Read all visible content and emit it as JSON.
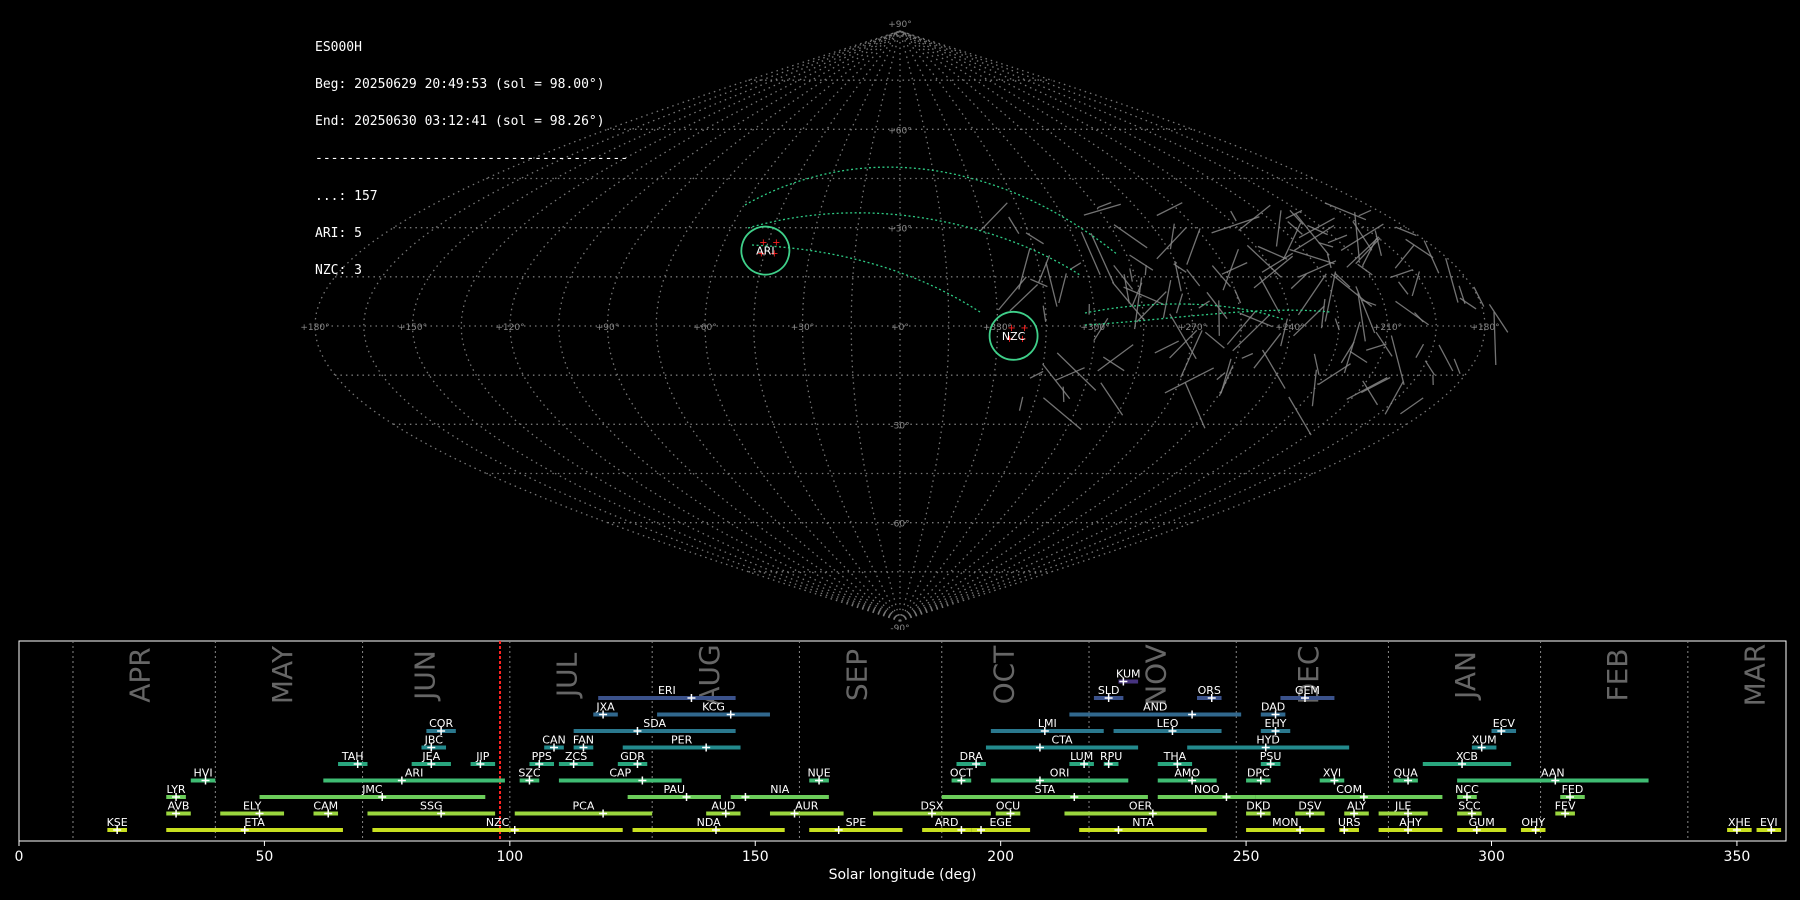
{
  "info": {
    "station": "ES000H",
    "begin": "Beg: 20250629 20:49:53 (sol = 98.00°)",
    "end": "End: 20250630 03:12:41 (sol = 98.26°)",
    "separator": "----------------------------------------",
    "counts": [
      "...: 157",
      "ARI: 5",
      "NZC: 3"
    ]
  },
  "sky_map": {
    "projection": "sinusoidal",
    "lon_labels": [
      "+180°",
      "+150°",
      "+120°",
      "+90°",
      "+60°",
      "+30°",
      "+0°",
      "+330°",
      "+300°",
      "+270°",
      "+240°",
      "+210°",
      "+180°"
    ],
    "lat_labels": [
      "+90°",
      "+60°",
      "+30°",
      "-30°",
      "-60°",
      "-90°"
    ],
    "radiants": [
      {
        "name": "ARI",
        "lon": 45,
        "lat": 23,
        "color": "#3fd08a"
      },
      {
        "name": "NZC",
        "lon": 325,
        "lat": -3,
        "color": "#3fd08a"
      }
    ],
    "colors": {
      "grid": "#777777",
      "sporadic": "#888888",
      "shower_arc": "#2ecc85",
      "radiant_point": "#ff2020"
    }
  },
  "chart_data": {
    "type": "timeline",
    "xlabel": "Solar longitude (deg)",
    "xlim": [
      0,
      360
    ],
    "xticks": [
      0,
      50,
      100,
      150,
      200,
      250,
      300,
      350
    ],
    "current_sol": 98.0,
    "month_boundaries": [
      11,
      40,
      70,
      100,
      129,
      159,
      188,
      218,
      248,
      279,
      310,
      340
    ],
    "months": [
      {
        "label": "APR",
        "sol": 25
      },
      {
        "label": "MAY",
        "sol": 54
      },
      {
        "label": "JUN",
        "sol": 83
      },
      {
        "label": "JUL",
        "sol": 112
      },
      {
        "label": "AUG",
        "sol": 141
      },
      {
        "label": "SEP",
        "sol": 171
      },
      {
        "label": "OCT",
        "sol": 201
      },
      {
        "label": "NOV",
        "sol": 232
      },
      {
        "label": "DEC",
        "sol": 263
      },
      {
        "label": "JAN",
        "sol": 295
      },
      {
        "label": "FEB",
        "sol": 326
      },
      {
        "label": "MAR",
        "sol": 354
      }
    ],
    "showers": [
      {
        "code": "KUM",
        "start": 224,
        "end": 228,
        "peak": 225,
        "row": 10
      },
      {
        "code": "ERI",
        "start": 118,
        "end": 146,
        "peak": 137,
        "row": 9
      },
      {
        "code": "SLD",
        "start": 219,
        "end": 225,
        "peak": 222,
        "row": 9
      },
      {
        "code": "ORS",
        "start": 240,
        "end": 245,
        "peak": 243,
        "row": 9
      },
      {
        "code": "GEM",
        "start": 257,
        "end": 268,
        "peak": 262,
        "row": 9
      },
      {
        "code": "JXA",
        "start": 117,
        "end": 122,
        "peak": 119,
        "row": 8
      },
      {
        "code": "KCG",
        "start": 130,
        "end": 153,
        "peak": 145,
        "row": 8
      },
      {
        "code": "AND",
        "start": 214,
        "end": 249,
        "peak": 239,
        "row": 8
      },
      {
        "code": "DAD",
        "start": 253,
        "end": 258,
        "peak": 256,
        "row": 8
      },
      {
        "code": "COR",
        "start": 83,
        "end": 89,
        "peak": 86,
        "row": 7
      },
      {
        "code": "SDA",
        "start": 113,
        "end": 146,
        "peak": 126,
        "row": 7
      },
      {
        "code": "LMI",
        "start": 198,
        "end": 221,
        "peak": 209,
        "row": 7
      },
      {
        "code": "LEO",
        "start": 223,
        "end": 245,
        "peak": 235,
        "row": 7
      },
      {
        "code": "EHY",
        "start": 253,
        "end": 259,
        "peak": 256,
        "row": 7
      },
      {
        "code": "ECV",
        "start": 300,
        "end": 305,
        "peak": 302,
        "row": 7
      },
      {
        "code": "JBC",
        "start": 82,
        "end": 87,
        "peak": 84,
        "row": 6
      },
      {
        "code": "CAN",
        "start": 107,
        "end": 111,
        "peak": 109,
        "row": 6
      },
      {
        "code": "FAN",
        "start": 113,
        "end": 117,
        "peak": 115,
        "row": 6
      },
      {
        "code": "PER",
        "start": 123,
        "end": 147,
        "peak": 140,
        "row": 6
      },
      {
        "code": "CTA",
        "start": 197,
        "end": 228,
        "peak": 208,
        "row": 6
      },
      {
        "code": "HYD",
        "start": 238,
        "end": 271,
        "peak": 254,
        "row": 6
      },
      {
        "code": "XUM",
        "start": 296,
        "end": 301,
        "peak": 298,
        "row": 6
      },
      {
        "code": "TAH",
        "start": 65,
        "end": 71,
        "peak": 69,
        "row": 5
      },
      {
        "code": "JEA",
        "start": 80,
        "end": 88,
        "peak": 84,
        "row": 5
      },
      {
        "code": "JIP",
        "start": 92,
        "end": 97,
        "peak": 94,
        "row": 5
      },
      {
        "code": "PPS",
        "start": 104,
        "end": 109,
        "peak": 106,
        "row": 5
      },
      {
        "code": "ZCS",
        "start": 110,
        "end": 117,
        "peak": 113,
        "row": 5
      },
      {
        "code": "GDR",
        "start": 122,
        "end": 128,
        "peak": 126,
        "row": 5
      },
      {
        "code": "DRA",
        "start": 191,
        "end": 197,
        "peak": 195,
        "row": 5
      },
      {
        "code": "LUM",
        "start": 214,
        "end": 219,
        "peak": 217,
        "row": 5
      },
      {
        "code": "RPU",
        "start": 221,
        "end": 224,
        "peak": 222,
        "row": 5
      },
      {
        "code": "THA",
        "start": 232,
        "end": 239,
        "peak": 236,
        "row": 5
      },
      {
        "code": "PSU",
        "start": 253,
        "end": 257,
        "peak": 255,
        "row": 5
      },
      {
        "code": "XCB",
        "start": 286,
        "end": 304,
        "peak": 294,
        "row": 5
      },
      {
        "code": "HVI",
        "start": 35,
        "end": 40,
        "peak": 38,
        "row": 4
      },
      {
        "code": "ARI",
        "start": 62,
        "end": 99,
        "peak": 78,
        "row": 4
      },
      {
        "code": "SZC",
        "start": 102,
        "end": 106,
        "peak": 104,
        "row": 4
      },
      {
        "code": "CAP",
        "start": 110,
        "end": 135,
        "peak": 127,
        "row": 4
      },
      {
        "code": "NUE",
        "start": 161,
        "end": 165,
        "peak": 163,
        "row": 4
      },
      {
        "code": "OCT",
        "start": 190,
        "end": 194,
        "peak": 192,
        "row": 4
      },
      {
        "code": "ORI",
        "start": 198,
        "end": 226,
        "peak": 208,
        "row": 4
      },
      {
        "code": "AMO",
        "start": 232,
        "end": 244,
        "peak": 239,
        "row": 4
      },
      {
        "code": "DPC",
        "start": 250,
        "end": 255,
        "peak": 253,
        "row": 4
      },
      {
        "code": "XVI",
        "start": 265,
        "end": 270,
        "peak": 268,
        "row": 4
      },
      {
        "code": "QUA",
        "start": 280,
        "end": 285,
        "peak": 283,
        "row": 4
      },
      {
        "code": "AAN",
        "start": 293,
        "end": 332,
        "peak": 313,
        "row": 4
      },
      {
        "code": "LYR",
        "start": 30,
        "end": 34,
        "peak": 32,
        "row": 3
      },
      {
        "code": "JMC",
        "start": 49,
        "end": 95,
        "peak": 74,
        "row": 3
      },
      {
        "code": "PAU",
        "start": 124,
        "end": 143,
        "peak": 136,
        "row": 3
      },
      {
        "code": "NIA",
        "start": 145,
        "end": 165,
        "peak": 148,
        "row": 3
      },
      {
        "code": "STA",
        "start": 188,
        "end": 230,
        "peak": 215,
        "row": 3
      },
      {
        "code": "NOO",
        "start": 232,
        "end": 252,
        "peak": 246,
        "row": 3
      },
      {
        "code": "COM",
        "start": 252,
        "end": 290,
        "peak": 274,
        "row": 3
      },
      {
        "code": "NCC",
        "start": 293,
        "end": 297,
        "peak": 295,
        "row": 3
      },
      {
        "code": "FED",
        "start": 314,
        "end": 319,
        "peak": 316,
        "row": 3
      },
      {
        "code": "AVB",
        "start": 30,
        "end": 35,
        "peak": 32,
        "row": 2
      },
      {
        "code": "ELY",
        "start": 41,
        "end": 54,
        "peak": 49,
        "row": 2
      },
      {
        "code": "CAM",
        "start": 60,
        "end": 65,
        "peak": 63,
        "row": 2
      },
      {
        "code": "SSG",
        "start": 71,
        "end": 97,
        "peak": 86,
        "row": 2
      },
      {
        "code": "PCA",
        "start": 101,
        "end": 129,
        "peak": 119,
        "row": 2
      },
      {
        "code": "AUD",
        "start": 140,
        "end": 147,
        "peak": 144,
        "row": 2
      },
      {
        "code": "AUR",
        "start": 153,
        "end": 168,
        "peak": 158,
        "row": 2
      },
      {
        "code": "DSX",
        "start": 174,
        "end": 198,
        "peak": 186,
        "row": 2
      },
      {
        "code": "OCU",
        "start": 199,
        "end": 204,
        "peak": 202,
        "row": 2
      },
      {
        "code": "OER",
        "start": 213,
        "end": 244,
        "peak": 231,
        "row": 2
      },
      {
        "code": "DKD",
        "start": 250,
        "end": 255,
        "peak": 253,
        "row": 2
      },
      {
        "code": "DSV",
        "start": 260,
        "end": 266,
        "peak": 263,
        "row": 2
      },
      {
        "code": "ALY",
        "start": 270,
        "end": 275,
        "peak": 272,
        "row": 2
      },
      {
        "code": "JLE",
        "start": 277,
        "end": 287,
        "peak": 283,
        "row": 2
      },
      {
        "code": "SCC",
        "start": 293,
        "end": 298,
        "peak": 296,
        "row": 2
      },
      {
        "code": "FEV",
        "start": 313,
        "end": 317,
        "peak": 315,
        "row": 2
      },
      {
        "code": "KSE",
        "start": 18,
        "end": 22,
        "peak": 20,
        "row": 1
      },
      {
        "code": "ETA",
        "start": 30,
        "end": 66,
        "peak": 46,
        "row": 1
      },
      {
        "code": "NZC",
        "start": 72,
        "end": 123,
        "peak": 101,
        "row": 1
      },
      {
        "code": "NDA",
        "start": 125,
        "end": 156,
        "peak": 142,
        "row": 1
      },
      {
        "code": "SPE",
        "start": 161,
        "end": 180,
        "peak": 167,
        "row": 1
      },
      {
        "code": "ARD",
        "start": 184,
        "end": 194,
        "peak": 192,
        "row": 1
      },
      {
        "code": "EGE",
        "start": 194,
        "end": 206,
        "peak": 196,
        "row": 1
      },
      {
        "code": "NTA",
        "start": 216,
        "end": 242,
        "peak": 224,
        "row": 1
      },
      {
        "code": "MON",
        "start": 250,
        "end": 266,
        "peak": 261,
        "row": 1
      },
      {
        "code": "URS",
        "start": 269,
        "end": 273,
        "peak": 270,
        "row": 1
      },
      {
        "code": "AHY",
        "start": 277,
        "end": 290,
        "peak": 283,
        "row": 1
      },
      {
        "code": "GUM",
        "start": 293,
        "end": 303,
        "peak": 297,
        "row": 1
      },
      {
        "code": "OHY",
        "start": 306,
        "end": 311,
        "peak": 309,
        "row": 1
      },
      {
        "code": "XHE",
        "start": 348,
        "end": 353,
        "peak": 350,
        "row": 1
      },
      {
        "code": "EVI",
        "start": 354,
        "end": 359,
        "peak": 357,
        "row": 1
      }
    ]
  }
}
